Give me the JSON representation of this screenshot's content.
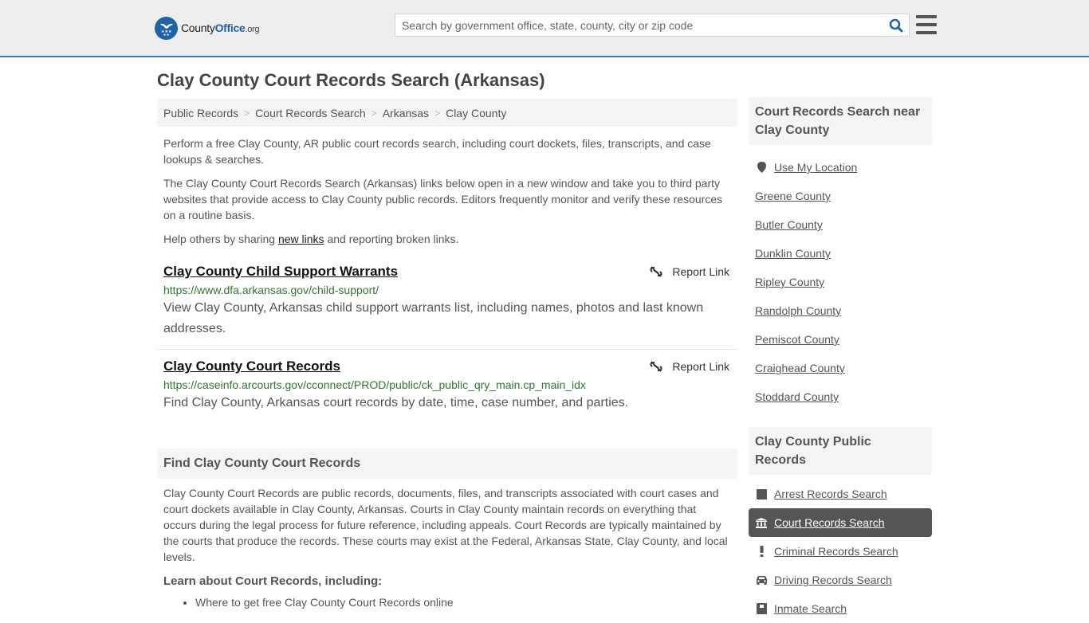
{
  "header": {
    "logo": {
      "name": "County",
      "office": "Office",
      "tld": ".org"
    },
    "search": {
      "placeholder": "Search by government office, state, county, city or zip code",
      "value": ""
    },
    "colors": {
      "brand": "#1e63a6",
      "header_border": "#3a7db0"
    }
  },
  "page": {
    "title": "Clay County Court Records Search (Arkansas)"
  },
  "breadcrumb": [
    {
      "label": "Public Records"
    },
    {
      "label": "Court Records Search"
    },
    {
      "label": "Arkansas"
    },
    {
      "label": "Clay County"
    }
  ],
  "intro": {
    "p1": "Perform a free Clay County, AR public court records search, including court dockets, files, transcripts, and case lookups & searches.",
    "p2": "The Clay County Court Records Search (Arkansas) links below open in a new window and take you to third party websites that provide access to Clay County public records. Editors frequently monitor and verify these resources on a routine basis.",
    "p3_before": "Help others by sharing ",
    "p3_link": "new links",
    "p3_after": " and reporting broken links."
  },
  "links": [
    {
      "title": "Clay County Child Support Warrants",
      "url": "https://www.dfa.arkansas.gov/child-support/",
      "description": "View Clay County, Arkansas child support warrants list, including names, photos and last known addresses.",
      "report_label": "Report Link"
    },
    {
      "title": "Clay County Court Records",
      "url": "https://caseinfo.arcourts.gov/cconnect/PROD/public/ck_public_qry_main.cp_main_idx",
      "description": "Find Clay County, Arkansas court records by date, time, case number, and parties.",
      "report_label": "Report Link"
    }
  ],
  "find_section": {
    "heading": "Find Clay County Court Records",
    "body": "Clay County Court Records are public records, documents, files, and transcripts associated with court cases and court dockets available in Clay County, Arkansas. Courts in Clay County maintain records on everything that occurs during the legal process for future reference, including appeals. Court Records are typically maintained by the courts that produce the records. These courts may exist at the Federal, Arkansas State, Clay County, and local levels.",
    "learn_heading": "Learn about Court Records, including:",
    "learn_items": [
      "Where to get free Clay County Court Records online"
    ]
  },
  "sidebar": {
    "near_heading": "Court Records Search near Clay County",
    "use_location": "Use My Location",
    "nearby": [
      "Greene County",
      "Butler County",
      "Dunklin County",
      "Ripley County",
      "Randolph County",
      "Pemiscot County",
      "Craighead County",
      "Stoddard County"
    ],
    "records_heading": "Clay County Public Records",
    "records": [
      {
        "label": "Arrest Records Search",
        "icon": "square-icon",
        "active": false
      },
      {
        "label": "Court Records Search",
        "icon": "courthouse-icon",
        "active": true
      },
      {
        "label": "Criminal Records Search",
        "icon": "exclamation-icon",
        "active": false
      },
      {
        "label": "Driving Records Search",
        "icon": "car-icon",
        "active": false
      },
      {
        "label": "Inmate Search",
        "icon": "inmate-icon",
        "active": false
      }
    ]
  }
}
